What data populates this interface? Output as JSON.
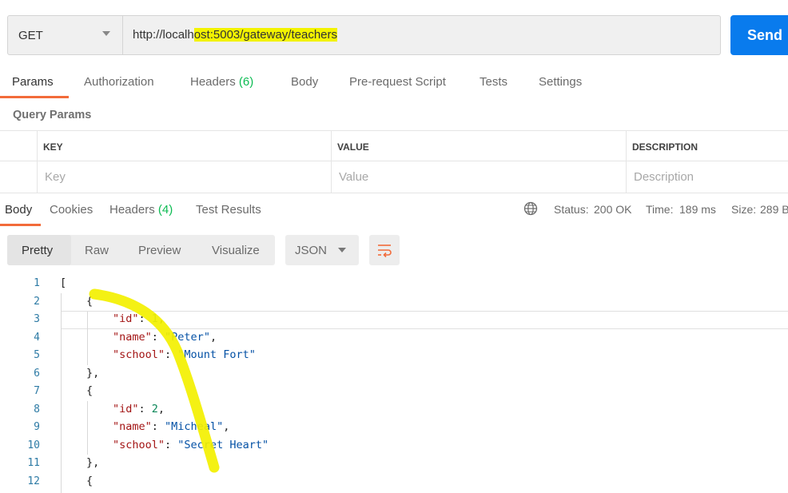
{
  "request": {
    "method": "GET",
    "url_prefix": "http://localh",
    "url_highlight": "ost:5003/gateway/teachers",
    "send_label": "Send"
  },
  "request_tabs": {
    "params": "Params",
    "authorization": "Authorization",
    "headers": "Headers",
    "headers_count": "(6)",
    "body": "Body",
    "prerequest": "Pre-request Script",
    "tests": "Tests",
    "settings": "Settings"
  },
  "query_params": {
    "title": "Query Params",
    "columns": [
      "KEY",
      "VALUE",
      "DESCRIPTION"
    ],
    "placeholders": [
      "Key",
      "Value",
      "Description"
    ]
  },
  "response_tabs": {
    "body": "Body",
    "cookies": "Cookies",
    "headers": "Headers",
    "headers_count": "(4)",
    "test_results": "Test Results"
  },
  "response_meta": {
    "status_label": "Status:",
    "status_value": "200 OK",
    "time_label": "Time:",
    "time_value": "189 ms",
    "size_label": "Size:",
    "size_value": "289 B"
  },
  "view_modes": [
    "Pretty",
    "Raw",
    "Preview",
    "Visualize"
  ],
  "format": "JSON",
  "icons": {
    "globe": "globe-icon",
    "wrap": "wrap-lines-icon",
    "caret": "chevron-down-icon"
  },
  "colors": {
    "send": "#097bed",
    "accent": "#f26b3a",
    "success": "#0cbb52",
    "highlight": "#f3f300"
  },
  "code": {
    "line_numbers": [
      "1",
      "2",
      "3",
      "4",
      "5",
      "6",
      "7",
      "8",
      "9",
      "10",
      "11",
      "12"
    ],
    "lines": [
      "[",
      "{",
      "\"id\": 1,",
      "\"name\": \"Peter\",",
      "\"school\": \"Mount Fort\"",
      "},",
      "{",
      "\"id\": 2,",
      "\"name\": \"Micheal\",",
      "\"school\": \"Secret Heart\"",
      "},",
      "{"
    ]
  }
}
